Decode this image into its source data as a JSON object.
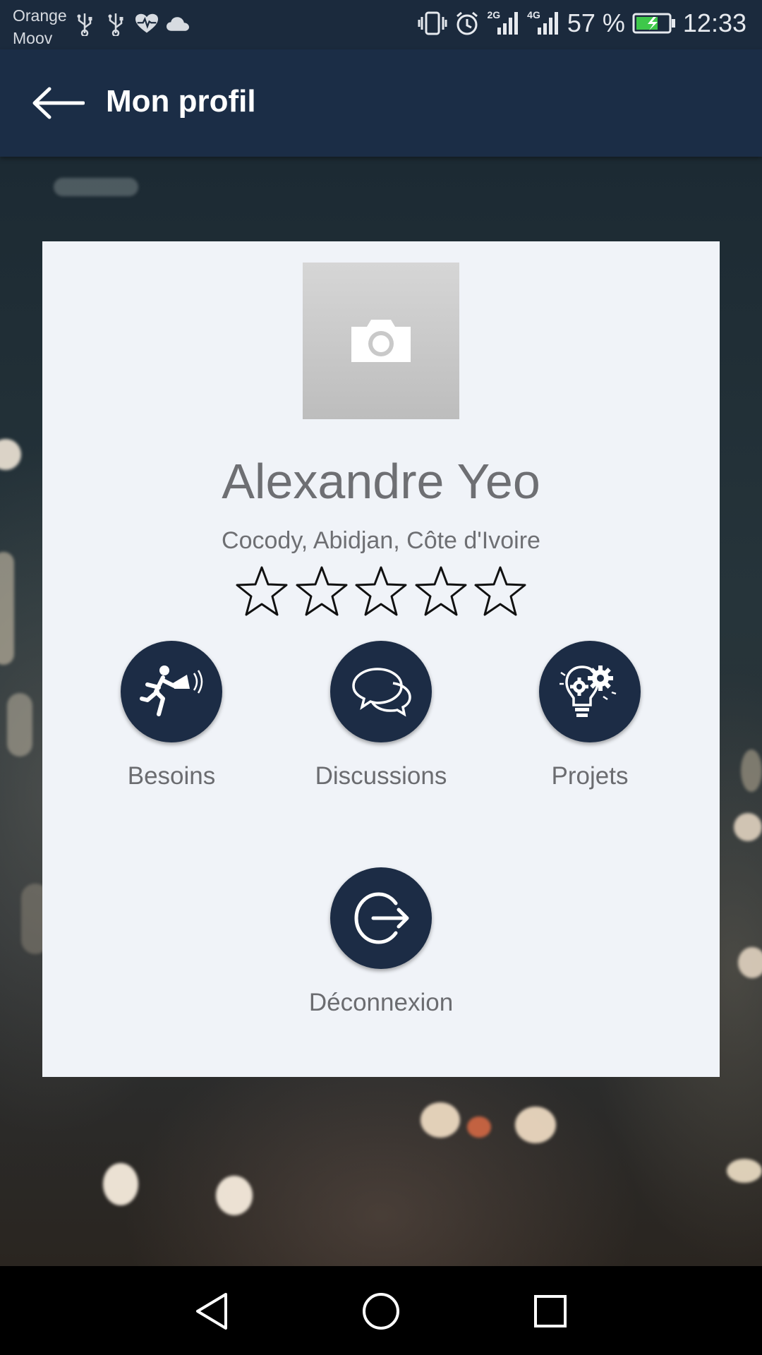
{
  "status_bar": {
    "carrier_primary": "Orange",
    "carrier_secondary": "Moov",
    "network_1": "2G",
    "network_2": "4G",
    "battery_percent": "57 %",
    "time": "12:33",
    "battery_color": "#3ec84a"
  },
  "app_bar": {
    "title": "Mon profil",
    "background_color": "#1b2d46"
  },
  "profile": {
    "name": "Alexandre Yeo",
    "location": "Cocody, Abidjan, Côte d'Ivoire",
    "rating": 0,
    "rating_max": 5
  },
  "actions": [
    {
      "label": "Besoins",
      "icon": "megaphone-runner-icon"
    },
    {
      "label": "Discussions",
      "icon": "chat-bubbles-icon"
    },
    {
      "label": "Projets",
      "icon": "lightbulb-gear-icon"
    }
  ],
  "logout": {
    "label": "Déconnexion",
    "icon": "logout-icon"
  },
  "colors": {
    "card_background": "#f0f3f8",
    "action_circle": "#1c2c45",
    "text_gray": "#6e6f73"
  }
}
